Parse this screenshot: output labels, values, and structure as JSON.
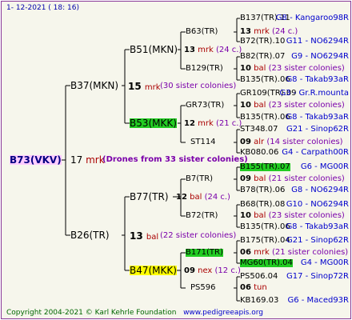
{
  "header": {
    "date": "1-  12-2021  (  18:  16)"
  },
  "root": {
    "name": "B73(VKV)",
    "count": "17",
    "unit": "mrk",
    "note": "(Drones from 33 sister colonies)"
  },
  "gen1": {
    "sire": {
      "name": "B37(MKN)",
      "count": "15",
      "unit": "mrk",
      "note": "(30 sister colonies)"
    },
    "dam": {
      "name": "B26(TR)",
      "count": "13",
      "unit": "bal",
      "note": "(22 sister colonies)"
    }
  },
  "gen2": [
    {
      "name": "B51(MKN)",
      "count": "13",
      "unit": "mrk",
      "note": "(24 c.)"
    },
    {
      "name": "B53(MKK)",
      "count": "12",
      "unit": "mrk",
      "note": "(21 c.)"
    },
    {
      "name": "B77(TR)",
      "count": "12",
      "unit": "bal",
      "note": "(24 c.)"
    },
    {
      "name": "B47(MKK)",
      "count": "09",
      "unit": "nex",
      "note": "(12 c.)"
    }
  ],
  "gen3": [
    {
      "name": "B63(TR)",
      "count": "13",
      "unit": "mrk",
      "note": "(24 c.)"
    },
    {
      "name": "B129(TR)",
      "count": "10",
      "unit": "bal",
      "note": "(23 sister colonies)"
    },
    {
      "name": "GR73(TR)",
      "count": "10",
      "unit": "bal",
      "note": "(23 sister colonies)"
    },
    {
      "name": "ST114",
      "count": "09",
      "unit": "alr",
      "note": "(14 sister colonies)"
    },
    {
      "name": "B7(TR)",
      "count": "09",
      "unit": "bal",
      "note": "(21 sister colonies)"
    },
    {
      "name": "B72(TR)",
      "count": "10",
      "unit": "bal",
      "note": "(23 sister colonies)"
    },
    {
      "name": "B171(TR)",
      "count": "06",
      "unit": "mrk",
      "note": "(21 sister colonies)"
    },
    {
      "name": "PS596",
      "count": "06",
      "unit": "tun",
      "note": ""
    }
  ],
  "gen4": [
    {
      "l": "B137(TR).11",
      "r": "G8 - Kangaroo98R"
    },
    {
      "l": "B72(TR).10",
      "r": "G11 - NO6294R"
    },
    {
      "l": "B82(TR).07",
      "r": "G9 - NO6294R"
    },
    {
      "l": "B135(TR).06",
      "r": "G8 - Takab93aR"
    },
    {
      "l": "GR109(TR).09",
      "r": "G3 - Gr.R.mounta"
    },
    {
      "l": "B135(TR).06",
      "r": "G8 - Takab93aR"
    },
    {
      "l": "ST348.07",
      "r": "G21 - Sinop62R"
    },
    {
      "l": "KB080.06",
      "r": "G4 - Carpath00R"
    },
    {
      "l": "B155(TR).07",
      "r": "G6 - MG00R"
    },
    {
      "l": "B78(TR).06",
      "r": "G8 - NO6294R"
    },
    {
      "l": "B68(TR).08",
      "r": "G10 - NO6294R"
    },
    {
      "l": "B135(TR).06",
      "r": "G8 - Takab93aR"
    },
    {
      "l": "B175(TR).04",
      "r": "G21 - Sinop62R"
    },
    {
      "l": "MG60(TR).04",
      "r": "G4 - MG00R"
    },
    {
      "l": "PS506.04",
      "r": "G17 - Sinop72R"
    },
    {
      "l": "KB169.03",
      "r": "G6 - Maced93R"
    }
  ],
  "footer": {
    "copyright": "Copyright 2004-2021 © Karl Kehrle Foundation",
    "url": "www.pedigreeapis.org"
  }
}
